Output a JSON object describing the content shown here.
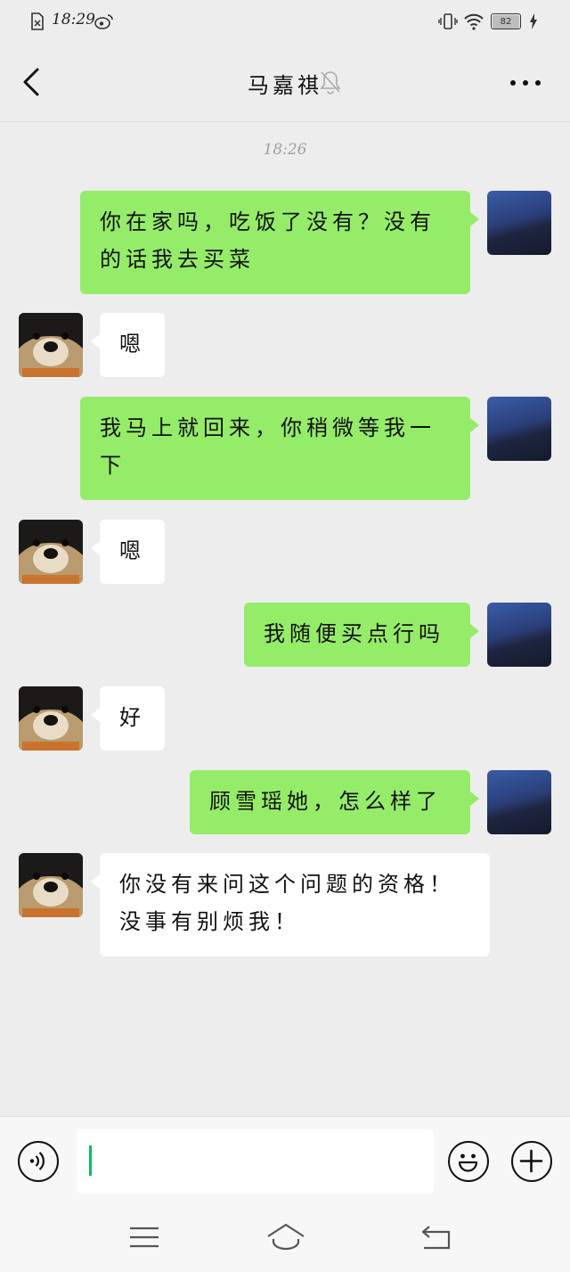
{
  "status_bar": {
    "time": "18:29",
    "battery": "82",
    "icons": [
      "sim-card-icon",
      "weibo-icon",
      "vibrate-icon",
      "wifi-icon",
      "battery-icon",
      "charging-icon"
    ]
  },
  "header": {
    "title": "马嘉祺",
    "icons": [
      "back-arrow-icon",
      "mute-bell-icon",
      "more-dots-icon"
    ]
  },
  "chat": {
    "timestamp": "18:26",
    "messages": [
      {
        "from": "me",
        "text": "你在家吗，吃饭了没有？没有的话我去买菜"
      },
      {
        "from": "other",
        "text": "嗯"
      },
      {
        "from": "me",
        "text": "我马上就回来，你稍微等我一下"
      },
      {
        "from": "other",
        "text": "嗯"
      },
      {
        "from": "me",
        "text": "我随便买点行吗"
      },
      {
        "from": "other",
        "text": "好"
      },
      {
        "from": "me",
        "text": "顾雪瑶她，怎么样了"
      },
      {
        "from": "other",
        "text": "你没有来问这个问题的资格！没事有别烦我！"
      }
    ]
  },
  "input_bar": {
    "value": "",
    "icons": [
      "voice-icon",
      "emoji-icon",
      "plus-icon"
    ]
  },
  "system_nav": {
    "icons": [
      "menu-icon",
      "home-icon",
      "back-icon"
    ]
  },
  "colors": {
    "background": "#ededed",
    "my_bubble": "#95ec69",
    "their_bubble": "#ffffff",
    "caret": "#07c160"
  }
}
